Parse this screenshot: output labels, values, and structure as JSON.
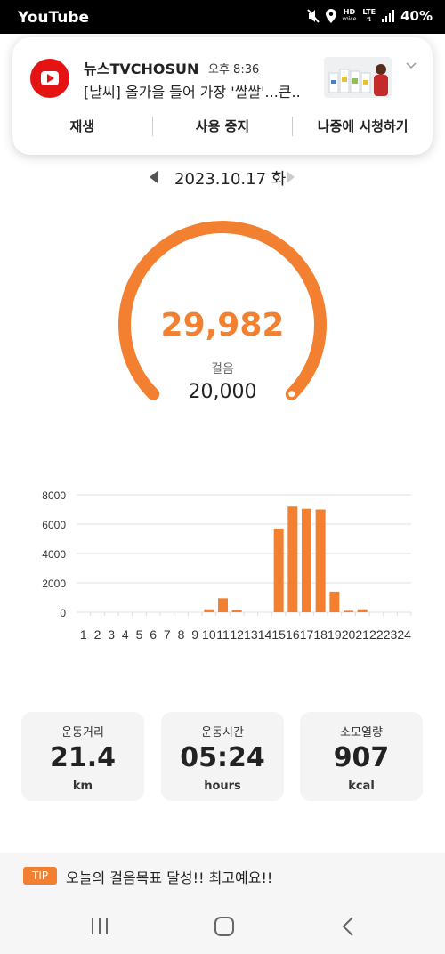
{
  "status_bar": {
    "app_name": "YouTube",
    "hd_label": "HD",
    "voice_label": "voice",
    "lte_label": "LTE",
    "battery": "40%"
  },
  "notification": {
    "channel": "뉴스TVCHOSUN",
    "time": "오후 8:36",
    "title": "[날씨] 올가을 들어 가장 '쌀쌀'...큰..",
    "actions": [
      "재생",
      "사용 중지",
      "나중에 시청하기"
    ]
  },
  "date_nav": {
    "date": "2023.10.17 화"
  },
  "gauge": {
    "steps": "29,982",
    "label": "걸음",
    "goal": "20,000",
    "progress": 1.0,
    "color": "#f28030"
  },
  "chart_data": {
    "type": "bar",
    "categories": [
      "1",
      "2",
      "3",
      "4",
      "5",
      "6",
      "7",
      "8",
      "9",
      "10",
      "11",
      "12",
      "13",
      "14",
      "15",
      "16",
      "17",
      "18",
      "19",
      "20",
      "21",
      "22",
      "23",
      "24"
    ],
    "values": [
      0,
      0,
      0,
      0,
      0,
      0,
      0,
      0,
      0,
      200,
      950,
      150,
      0,
      0,
      5700,
      7200,
      7050,
      7000,
      1400,
      100,
      200,
      0,
      0,
      0
    ],
    "y_ticks": [
      0,
      2000,
      4000,
      6000,
      8000
    ],
    "ylim": [
      0,
      8000
    ],
    "grid": true,
    "color": "#f28030"
  },
  "stats": [
    {
      "title": "운동거리",
      "value": "21.4",
      "unit": "km"
    },
    {
      "title": "운동시간",
      "value": "05:24",
      "unit": "hours"
    },
    {
      "title": "소모열량",
      "value": "907",
      "unit": "kcal"
    }
  ],
  "tip": {
    "badge": "TIP",
    "text": "오늘의 걸음목표 달성!! 최고예요!!"
  },
  "icons": [
    "youtube-icon",
    "mute-icon",
    "location-icon",
    "signal-icon",
    "chevron-down-icon",
    "prev-date-icon",
    "next-date-icon",
    "recent-apps-icon",
    "home-icon",
    "back-icon"
  ]
}
